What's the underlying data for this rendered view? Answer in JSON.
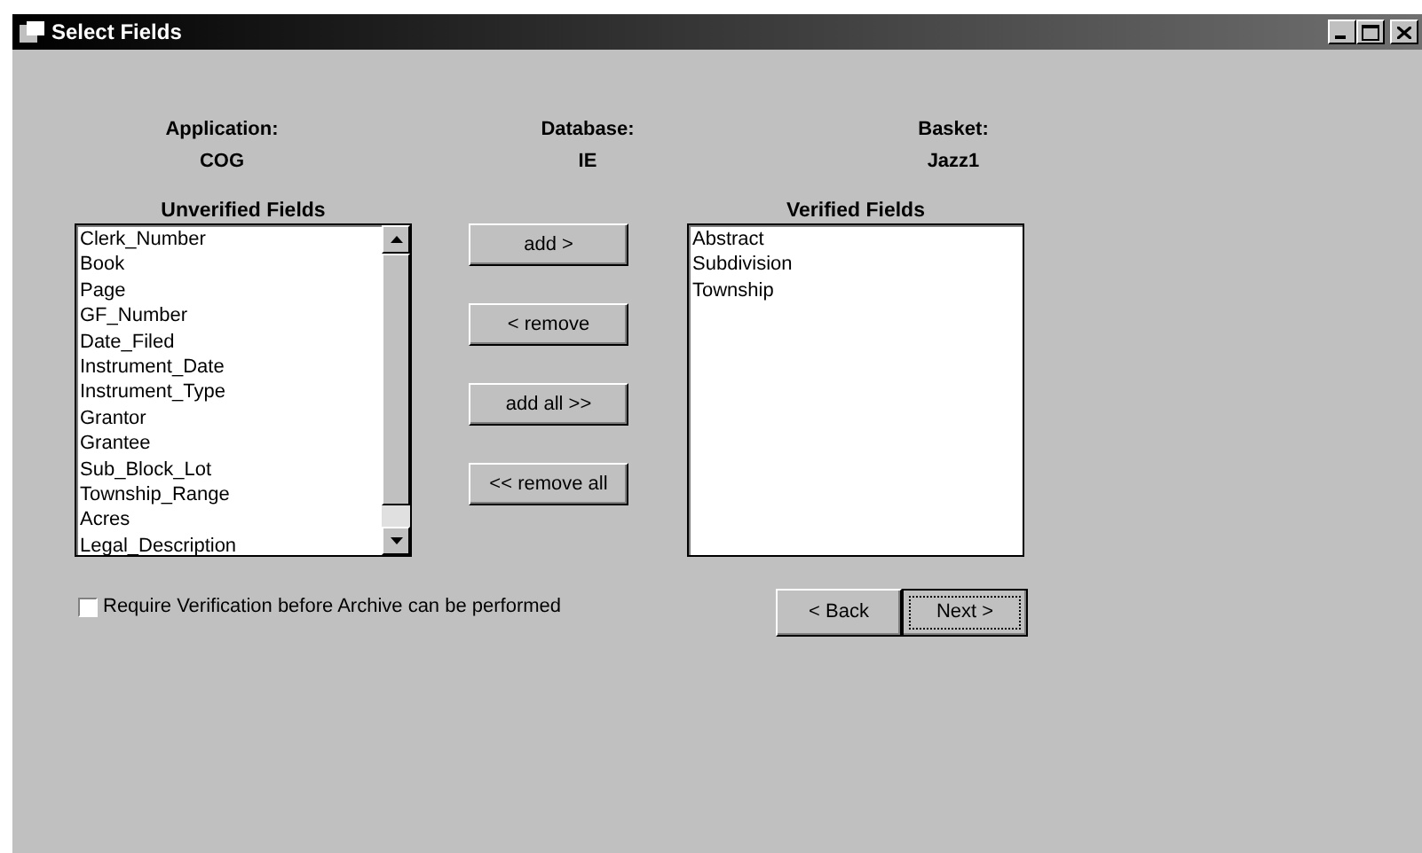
{
  "window": {
    "title": "Select Fields"
  },
  "info": [
    {
      "label": "Application:",
      "value": "COG"
    },
    {
      "label": "Database:",
      "value": "IE"
    },
    {
      "label": "Basket:",
      "value": "Jazz1"
    }
  ],
  "unverified": {
    "title": "Unverified Fields",
    "items": [
      "Clerk_Number",
      "Book",
      "Page",
      "GF_Number",
      "Date_Filed",
      "Instrument_Date",
      "Instrument_Type",
      "Grantor",
      "Grantee",
      "Sub_Block_Lot",
      "Township_Range",
      "Acres",
      "Legal_Description"
    ]
  },
  "actions": [
    "add >",
    "< remove",
    "add all >>",
    "<< remove all"
  ],
  "verified": {
    "title": "Verified Fields",
    "items": [
      "Abstract",
      "Subdivision",
      "Township"
    ]
  },
  "require_verification": {
    "label": "Require Verification before Archive can be performed",
    "checked": false
  },
  "nav_buttons": [
    {
      "label": "< Back",
      "default": false
    },
    {
      "label": "Next >",
      "default": true
    }
  ]
}
